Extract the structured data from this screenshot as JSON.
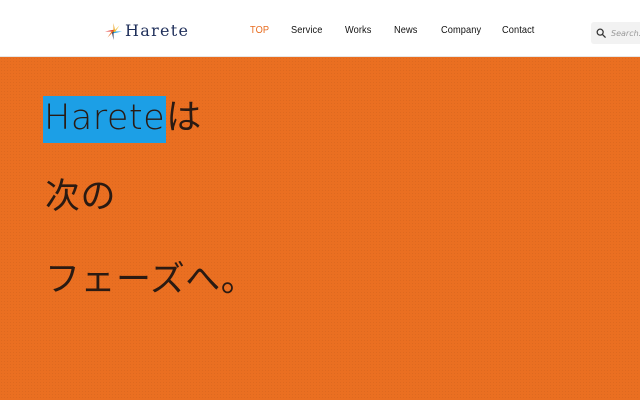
{
  "brand": {
    "name": "Harete"
  },
  "nav": {
    "items": [
      {
        "label": "TOP",
        "active": true
      },
      {
        "label": "Service",
        "active": false
      },
      {
        "label": "Works",
        "active": false
      },
      {
        "label": "News",
        "active": false
      },
      {
        "label": "Company",
        "active": false
      },
      {
        "label": "Contact",
        "active": false
      }
    ],
    "active_color": "#e86c1f"
  },
  "search": {
    "placeholder": "Search..."
  },
  "hero": {
    "line1_highlight": "Harete",
    "line1_rest": "は",
    "line2": "次の",
    "line3": "フェーズへ。",
    "background_color": "#ea6f21",
    "highlight_color": "#1c9fe6"
  }
}
